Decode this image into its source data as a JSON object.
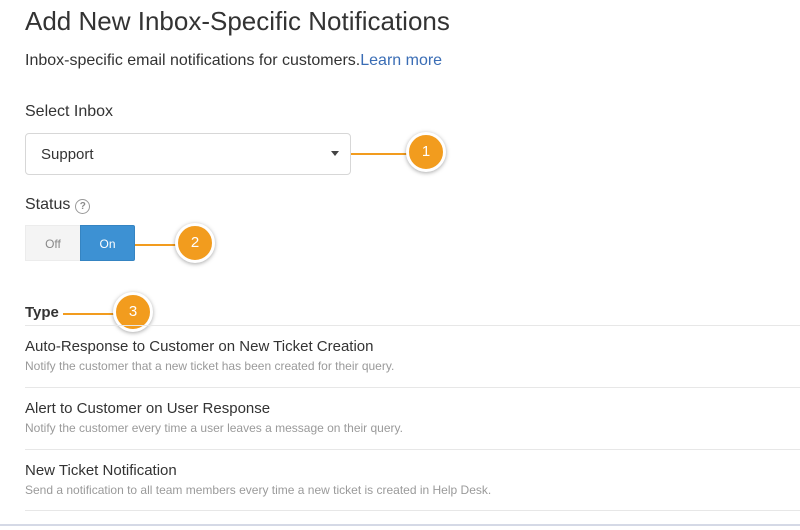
{
  "header": {
    "title": "Add New Inbox-Specific Notifications",
    "subtitle": "Inbox-specific email notifications for customers.",
    "learn_more": "Learn more"
  },
  "inbox": {
    "label": "Select Inbox",
    "selected": "Support"
  },
  "status": {
    "label": "Status",
    "help_icon": "?",
    "off_label": "Off",
    "on_label": "On",
    "active": "On"
  },
  "type": {
    "heading": "Type",
    "items": [
      {
        "name": "Auto-Response to Customer on New Ticket Creation",
        "description": "Notify the customer that a new ticket has been created for their query."
      },
      {
        "name": "Alert to Customer on User Response",
        "description": "Notify the customer every time a user leaves a message on their query."
      },
      {
        "name": "New Ticket Notification",
        "description": "Send a notification to all team members every time a new ticket is created in Help Desk."
      }
    ]
  },
  "callouts": [
    "1",
    "2",
    "3"
  ],
  "colors": {
    "accent_orange": "#f29c1e",
    "toggle_on": "#3d91d3",
    "link": "#3a6db5"
  }
}
